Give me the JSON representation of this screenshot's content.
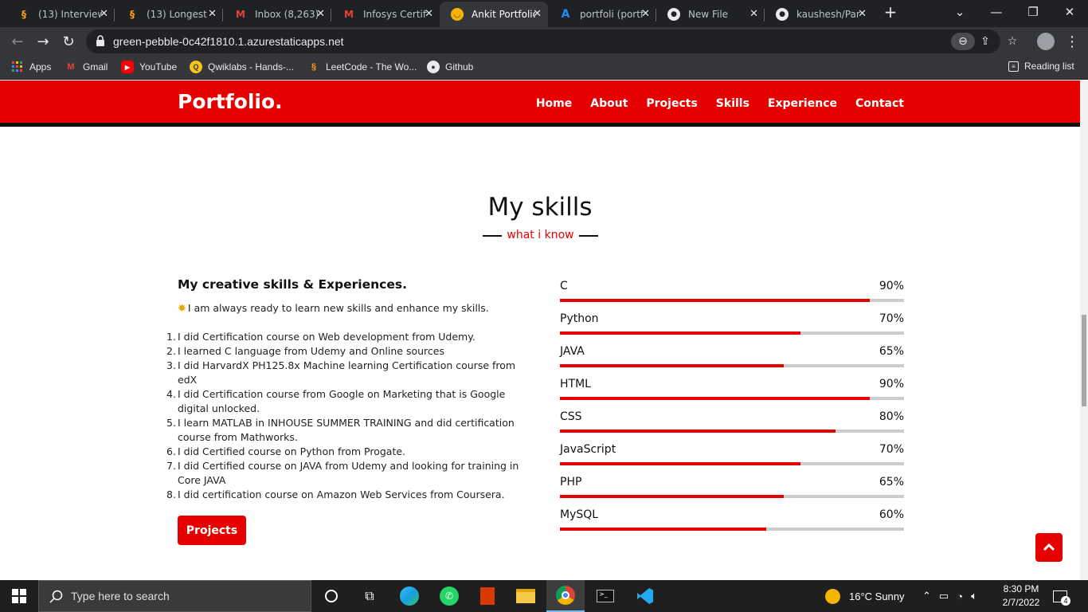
{
  "browser": {
    "tabs": [
      {
        "title": "(13) Interview",
        "icon": "leetcode-icon"
      },
      {
        "title": "(13) Longest",
        "icon": "leetcode-icon"
      },
      {
        "title": "Inbox (8,263)",
        "icon": "gmail-icon"
      },
      {
        "title": "Infosys Certifi",
        "icon": "gmail-icon"
      },
      {
        "title": "Ankit Portfolio",
        "icon": "emoji-icon",
        "active": true
      },
      {
        "title": "portfoli (portf",
        "icon": "azure-icon"
      },
      {
        "title": "New File",
        "icon": "github-icon"
      },
      {
        "title": "kaushesh/Par",
        "icon": "github-icon"
      }
    ],
    "url": "green-pebble-0c42f1810.1.azurestaticapps.net",
    "bookmarks": [
      {
        "label": "Apps",
        "icon": "apps-grid-icon"
      },
      {
        "label": "Gmail",
        "icon": "gmail-icon"
      },
      {
        "label": "YouTube",
        "icon": "youtube-icon"
      },
      {
        "label": "Qwiklabs - Hands-...",
        "icon": "qwiklabs-icon"
      },
      {
        "label": "LeetCode - The Wo...",
        "icon": "leetcode-icon"
      },
      {
        "label": "Github",
        "icon": "github-icon"
      }
    ],
    "reading_list": "Reading list"
  },
  "site": {
    "logo": "Portfolio.",
    "nav": [
      "Home",
      "About",
      "Projects",
      "Skills",
      "Experience",
      "Contact"
    ],
    "section_title": "My skills",
    "section_subtitle": "what i know",
    "left_heading": "My creative skills & Experiences.",
    "intro": "I am always ready to learn new skills and enhance my skills.",
    "points": [
      "I did Certification course on Web development from Udemy.",
      "I learned C language from Udemy and Online sources",
      "I did HarvardX PH125.8x Machine learning Certification course from edX",
      "I did Certification course from Google on Marketing that is Google digital unlocked.",
      "I learn MATLAB in INHOUSE SUMMER TRAINING and did certification course from Mathworks.",
      "I did Certified course on Python from Progate.",
      "I did Certified course on JAVA from Udemy and looking for training in Core JAVA",
      "I did certification course on Amazon Web Services from Coursera."
    ],
    "projects_button": "Projects",
    "skills": [
      {
        "name": "C",
        "percent": 90,
        "label": "90%"
      },
      {
        "name": "Python",
        "percent": 70,
        "label": "70%"
      },
      {
        "name": "JAVA",
        "percent": 65,
        "label": "65%"
      },
      {
        "name": "HTML",
        "percent": 90,
        "label": "90%"
      },
      {
        "name": "CSS",
        "percent": 80,
        "label": "80%"
      },
      {
        "name": "JavaScript",
        "percent": 70,
        "label": "70%"
      },
      {
        "name": "PHP",
        "percent": 65,
        "label": "65%"
      },
      {
        "name": "MySQL",
        "percent": 60,
        "label": "60%"
      }
    ],
    "accent_color": "#e60000"
  },
  "taskbar": {
    "search_placeholder": "Type here to search",
    "weather": "16°C  Sunny",
    "time": "8:30 PM",
    "date": "2/7/2022",
    "notifications": "4"
  }
}
